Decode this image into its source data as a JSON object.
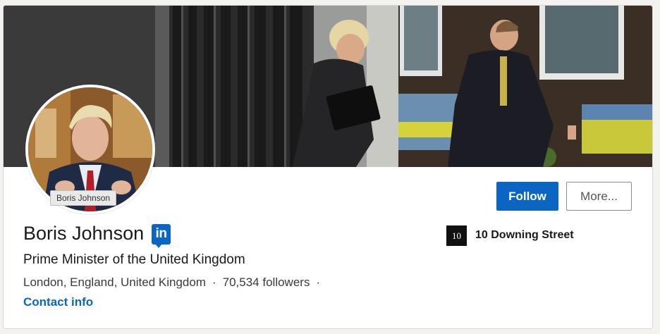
{
  "profile": {
    "name": "Boris Johnson",
    "avatar_tag": "Boris Johnson",
    "headline": "Prime Minister of the United Kingdom",
    "location": "London, England, United Kingdom",
    "followers": "70,534 followers",
    "separator": "·",
    "contact_label": "Contact info"
  },
  "badge": {
    "text": "in",
    "icon": "linkedin-icon"
  },
  "actions": {
    "follow_label": "Follow",
    "more_label": "More..."
  },
  "company": {
    "logo_text": "10",
    "name": "10 Downing Street"
  },
  "colors": {
    "accent": "#0a66c2",
    "text": "#191919",
    "muted": "#3a3a3a"
  }
}
